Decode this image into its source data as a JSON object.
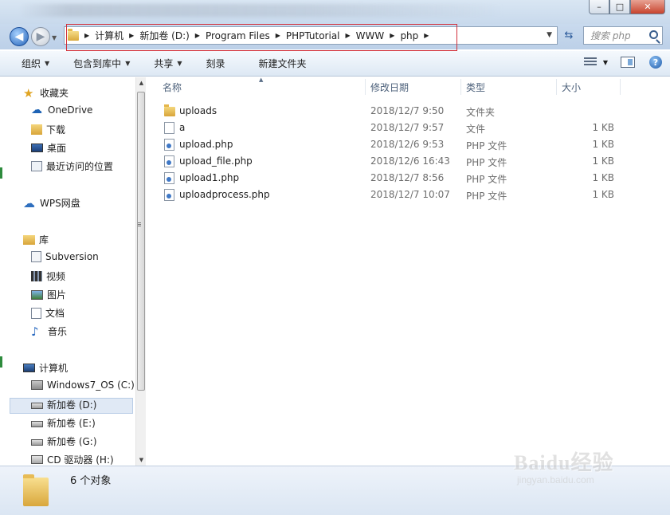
{
  "window": {
    "buttons": {
      "minimize": "–",
      "maximize": "□",
      "close": "✕"
    }
  },
  "address": {
    "crumbs": [
      "计算机",
      "新加卷 (D:)",
      "Program Files",
      "PHPTutorial",
      "WWW",
      "php"
    ],
    "search_placeholder": "搜索 php"
  },
  "toolbar": {
    "items": [
      "组织",
      "包含到库中",
      "共享",
      "刻录",
      "新建文件夹"
    ]
  },
  "navigation": {
    "favorites_label": "收藏夹",
    "favorites": [
      "OneDrive",
      "下载",
      "桌面",
      "最近访问的位置"
    ],
    "wps_label": "WPS网盘",
    "libraries_label": "库",
    "libraries": [
      "Subversion",
      "视频",
      "图片",
      "文档",
      "音乐"
    ],
    "computer_label": "计算机",
    "drives": [
      "Windows7_OS (C:)",
      "新加卷 (D:)",
      "新加卷 (E:)",
      "新加卷 (G:)",
      "CD 驱动器 (H:)"
    ],
    "selected": "新加卷 (D:)"
  },
  "columns": {
    "name": "名称",
    "date": "修改日期",
    "type": "类型",
    "size": "大小"
  },
  "files": [
    {
      "name": "uploads",
      "date": "2018/12/7 9:50",
      "type": "文件夹",
      "size": "",
      "icon": "folder-icon"
    },
    {
      "name": "a",
      "date": "2018/12/7 9:57",
      "type": "文件",
      "size": "1 KB",
      "icon": "file-icon"
    },
    {
      "name": "upload.php",
      "date": "2018/12/6 9:53",
      "type": "PHP 文件",
      "size": "1 KB",
      "icon": "php-file-icon"
    },
    {
      "name": "upload_file.php",
      "date": "2018/12/6 16:43",
      "type": "PHP 文件",
      "size": "1 KB",
      "icon": "php-file-icon"
    },
    {
      "name": "upload1.php",
      "date": "2018/12/7 8:56",
      "type": "PHP 文件",
      "size": "1 KB",
      "icon": "php-file-icon"
    },
    {
      "name": "uploadprocess.php",
      "date": "2018/12/7 10:07",
      "type": "PHP 文件",
      "size": "1 KB",
      "icon": "php-file-icon"
    }
  ],
  "status": {
    "count_text": "6 个对象"
  },
  "watermark": {
    "main": "Baidu经验",
    "sub": "jingyan.baidu.com"
  },
  "colors": {
    "highlight_border": "#d2303a",
    "selected_bg": "#e0e9f5"
  }
}
